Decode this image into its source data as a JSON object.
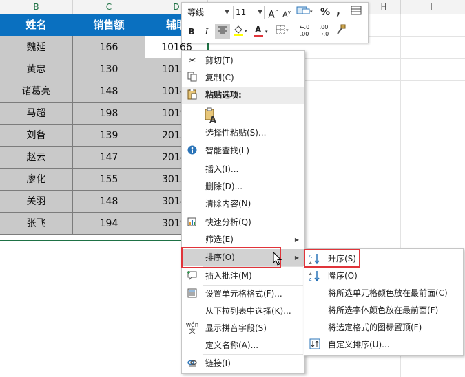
{
  "sheet": {
    "column_headers": [
      "B",
      "C",
      "D",
      "H",
      "I"
    ],
    "table_headers": [
      "姓名",
      "销售额",
      "辅助"
    ],
    "rows": [
      {
        "name": "魏延",
        "sales": "166",
        "aux": "10166"
      },
      {
        "name": "黄忠",
        "sales": "130",
        "aux": "1013"
      },
      {
        "name": "诸葛亮",
        "sales": "148",
        "aux": "1014"
      },
      {
        "name": "马超",
        "sales": "198",
        "aux": "1019"
      },
      {
        "name": "刘备",
        "sales": "139",
        "aux": "2013"
      },
      {
        "name": "赵云",
        "sales": "147",
        "aux": "2014"
      },
      {
        "name": "廖化",
        "sales": "155",
        "aux": "3015"
      },
      {
        "name": "关羽",
        "sales": "148",
        "aux": "3014"
      },
      {
        "name": "张飞",
        "sales": "194",
        "aux": "3019"
      }
    ]
  },
  "mini_toolbar": {
    "font_name": "等线",
    "font_size": "11",
    "increase_font": "A",
    "decrease_font": "A",
    "percent": "%",
    "comma": ",",
    "bold": "B",
    "italic": "I",
    "font_color_letter": "A",
    "increase_decimal": "←.0 .00",
    "decrease_decimal": ".00 →.0"
  },
  "context_menu": {
    "cut": "剪切(T)",
    "copy": "复制(C)",
    "paste_options": "粘贴选项:",
    "paste_special": "选择性粘贴(S)...",
    "smart_lookup": "智能查找(L)",
    "insert": "插入(I)...",
    "delete": "删除(D)...",
    "clear_contents": "清除内容(N)",
    "quick_analysis": "快速分析(Q)",
    "filter": "筛选(E)",
    "sort": "排序(O)",
    "insert_comment": "插入批注(M)",
    "format_cells": "设置单元格格式(F)...",
    "pick_from_list": "从下拉列表中选择(K)...",
    "phonetic": "显示拼音字段(S)",
    "define_name": "定义名称(A)...",
    "link": "链接(I)"
  },
  "sort_submenu": {
    "ascending": "升序(S)",
    "descending": "降序(O)",
    "cell_color_top": "将所选单元格颜色放在最前面(C)",
    "font_color_top": "将所选字体颜色放在最前面(F)",
    "icon_top": "将选定格式的图标置顶(F)",
    "custom_sort": "自定义排序(U)..."
  },
  "colors": {
    "header_blue": "#0a70c0",
    "cell_gray": "#c9c9c9",
    "highlight_red": "#e0343a",
    "selection_green": "#1e7145"
  }
}
